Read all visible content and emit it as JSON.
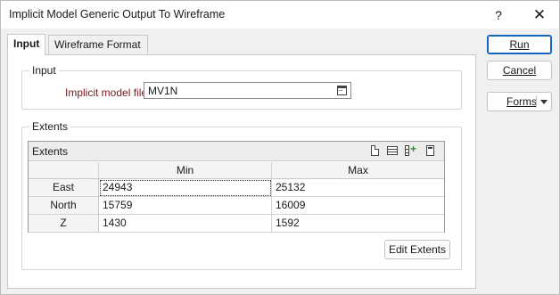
{
  "window": {
    "title": "Implicit Model Generic Output To Wireframe",
    "help_glyph": "?",
    "close_glyph": "✕"
  },
  "tabs": [
    {
      "label": "Input",
      "active": true
    },
    {
      "label": "Wireframe Format",
      "active": false
    }
  ],
  "input_group": {
    "title": "Input",
    "field_label": "Implicit model file",
    "field_value": "MV1N"
  },
  "extents_group": {
    "title": "Extents",
    "grid_title": "Extents",
    "columns": [
      "Min",
      "Max"
    ],
    "rows": [
      {
        "label": "East",
        "min": "24943",
        "max": "25132"
      },
      {
        "label": "North",
        "min": "15759",
        "max": "16009"
      },
      {
        "label": "Z",
        "min": "1430",
        "max": "1592"
      }
    ],
    "toolbar_icons": [
      "new-page-icon",
      "table-icon",
      "insert-column-icon",
      "calculator-icon"
    ],
    "edit_button": "Edit Extents"
  },
  "buttons": {
    "run": "Run",
    "cancel": "Cancel",
    "forms": "Forms"
  },
  "colors": {
    "field_label": "#7a1a1a",
    "accent_border": "#1466c1"
  }
}
